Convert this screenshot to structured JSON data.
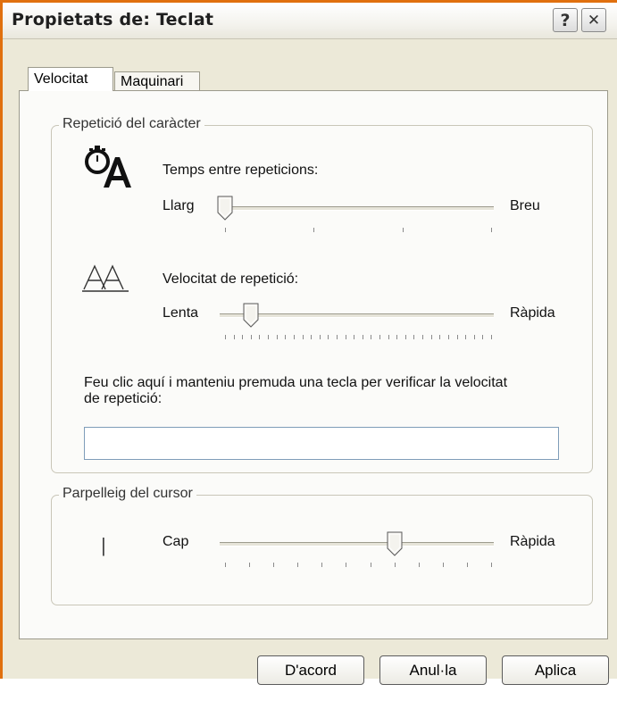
{
  "window": {
    "title": "Propietats de: Teclat",
    "help_glyph": "?",
    "close_glyph": "✕"
  },
  "tabs": [
    {
      "label": "Velocitat",
      "active": true
    },
    {
      "label": "Maquinari",
      "active": false
    }
  ],
  "repeat_group": {
    "legend": "Repetició del caràcter",
    "delay": {
      "label": "Temps entre repeticions:",
      "min_label": "Llarg",
      "max_label": "Breu",
      "steps": 4,
      "value_index": 0
    },
    "rate": {
      "label": "Velocitat de repetició:",
      "min_label": "Lenta",
      "max_label": "Ràpida",
      "steps": 32,
      "value_index": 3
    },
    "test_prompt_line1": "Feu clic aquí i manteniu premuda una tecla per verificar la velocitat",
    "test_prompt_line2": "de repetició:",
    "test_value": ""
  },
  "blink_group": {
    "legend": "Parpelleig del cursor",
    "cursor_glyph": "|",
    "min_label": "Cap",
    "max_label": "Ràpida",
    "steps": 12,
    "value_index": 7
  },
  "buttons": {
    "ok": "D'acord",
    "cancel": "Anul·la",
    "apply": "Aplica"
  },
  "colors": {
    "window_border": "#e0700e",
    "dialog_bg": "#ece9d8",
    "input_border": "#7f9db9"
  }
}
